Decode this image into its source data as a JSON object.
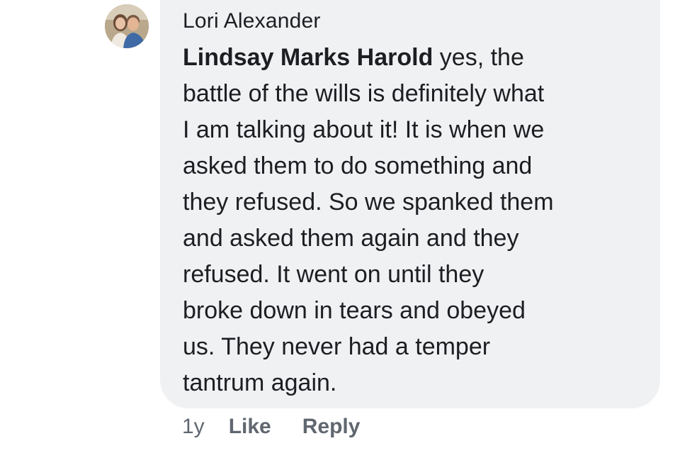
{
  "comment": {
    "author": "Lori Alexander",
    "mention": "Lindsay Marks Harold",
    "text": " yes, the\nbattle of the wills is definitely what\nI am talking about it! It is when we\nasked them to do something and\nthey refused. So we spanked them\nand asked them again and they\nrefused. It went on until they\nbroke down in tears and obeyed\nus. They never had a temper\ntantrum again.",
    "avatar_icon": "profile-photo-couple"
  },
  "actions": {
    "timestamp": "1y",
    "like_label": "Like",
    "reply_label": "Reply"
  },
  "colors": {
    "bubble_background": "#f0f1f3",
    "text": "#1c1e21",
    "meta_text": "#606770"
  }
}
